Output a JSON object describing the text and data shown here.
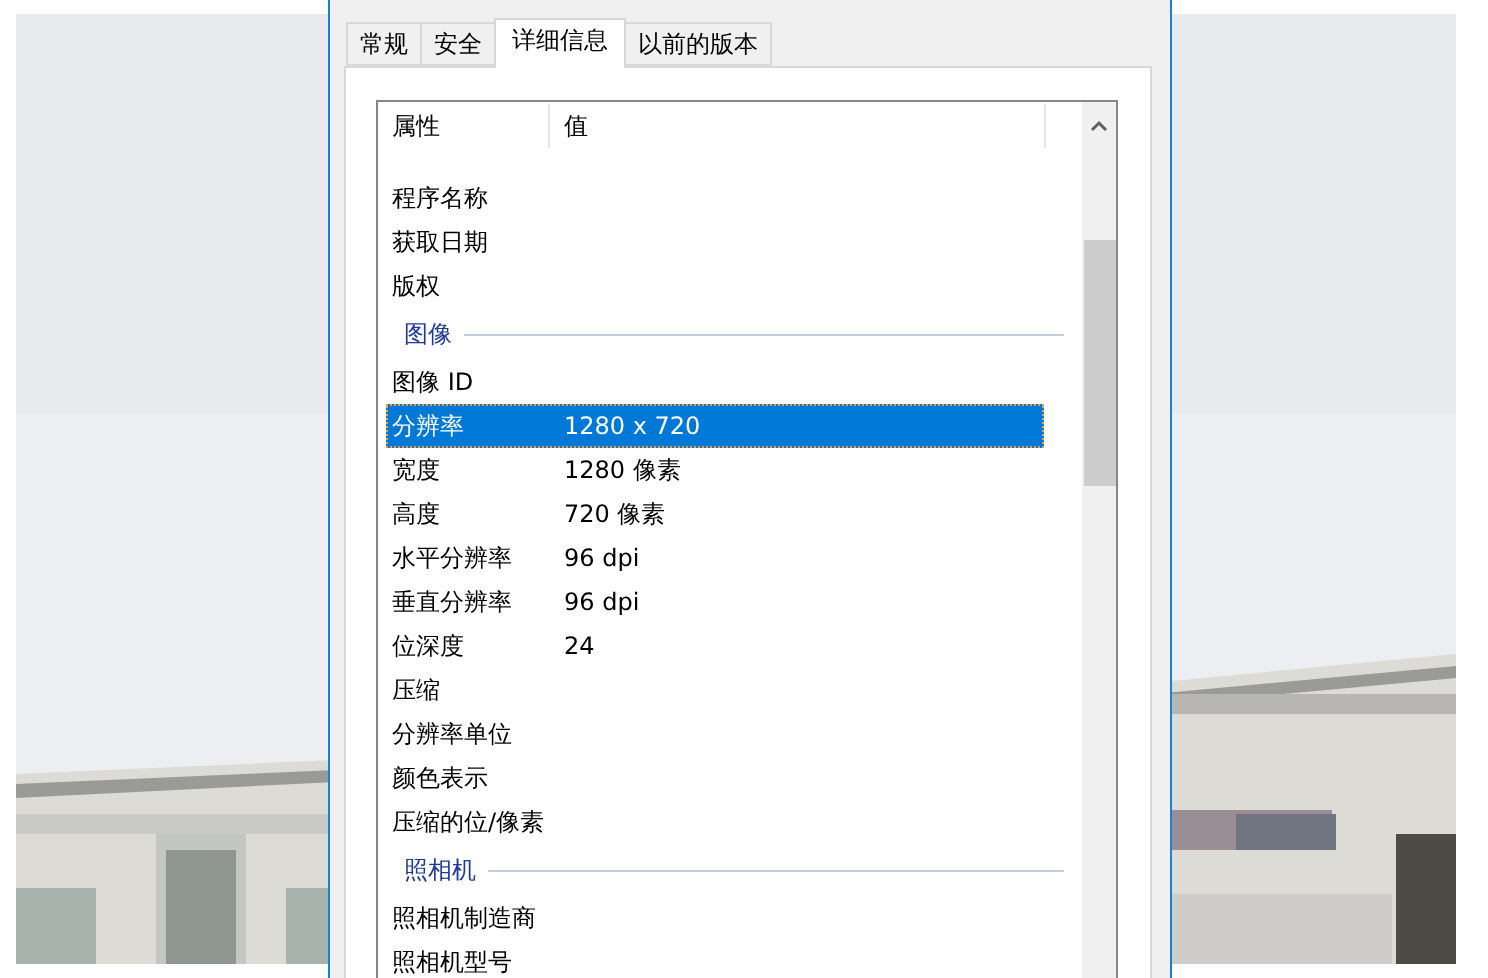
{
  "tabs": [
    {
      "label": "常规",
      "selected": false
    },
    {
      "label": "安全",
      "selected": false
    },
    {
      "label": "详细信息",
      "selected": true
    },
    {
      "label": "以前的版本",
      "selected": false
    }
  ],
  "list": {
    "columns": [
      "属性",
      "值"
    ],
    "rows": [
      {
        "kind": "property",
        "label": "程序名称",
        "selected": false
      },
      {
        "kind": "property",
        "label": "获取日期",
        "selected": false
      },
      {
        "kind": "property",
        "label": "版权",
        "selected": false
      },
      {
        "kind": "group",
        "label": "图像"
      },
      {
        "kind": "property",
        "label": "图像 ID",
        "selected": false
      },
      {
        "kind": "property",
        "label": "分辨率",
        "value": "1280 x 720",
        "selected": true
      },
      {
        "kind": "property",
        "label": "宽度",
        "value": "1280 像素",
        "selected": false
      },
      {
        "kind": "property",
        "label": "高度",
        "value": "720 像素",
        "selected": false
      },
      {
        "kind": "property",
        "label": "水平分辨率",
        "value": "96 dpi",
        "selected": false
      },
      {
        "kind": "property",
        "label": "垂直分辨率",
        "value": "96 dpi",
        "selected": false
      },
      {
        "kind": "property",
        "label": "位深度",
        "value": "24",
        "selected": false
      },
      {
        "kind": "property",
        "label": "压缩",
        "selected": false
      },
      {
        "kind": "property",
        "label": "分辨率单位",
        "selected": false
      },
      {
        "kind": "property",
        "label": "颜色表示",
        "selected": false
      },
      {
        "kind": "property",
        "label": "压缩的位/像素",
        "selected": false
      },
      {
        "kind": "group",
        "label": "照相机"
      },
      {
        "kind": "property",
        "label": "照相机制造商",
        "selected": false
      },
      {
        "kind": "property",
        "label": "照相机型号",
        "selected": false
      }
    ]
  }
}
